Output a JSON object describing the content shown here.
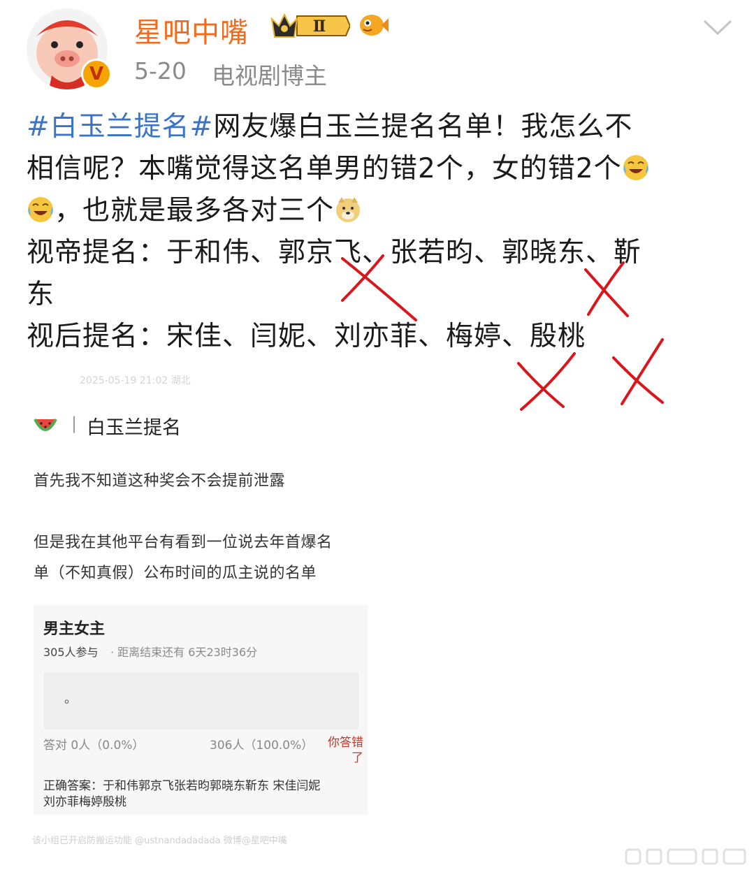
{
  "header": {
    "username": "星吧中嘴",
    "badge_level": "Ⅱ",
    "date": "5-20",
    "role": "电视剧博主"
  },
  "post": {
    "hashtag": "#白玉兰提名#",
    "line1_text": "网友爆白玉兰提名名单！我怎么不",
    "line2_text": "相信呢？本嘴觉得这名单男的错2个，女的错2个",
    "line3_text": "，也就是最多各对三个",
    "actor_line": "视帝提名：于和伟、郭京飞、张若昀、郭晓东、靳",
    "actor_line_cont": "东",
    "actress_line": "视后提名：宋佳、闫妮、刘亦菲、梅婷、殷桃"
  },
  "screenshot": {
    "faint_header": "2025-05-19 21:02 湖北",
    "topic_sep": "|",
    "topic": "白玉兰提名",
    "para1": "首先我不知道这种奖会不会提前泄露",
    "para2_line1": "但是我在其他平台有看到一位说去年首爆名",
    "para2_line2": "单（不知真假）公布时间的瓜主说的名单",
    "card": {
      "title": "男主女主",
      "participants": "305人参与",
      "deadline": "· 距离结束还有 6天23时36分",
      "option_text": "。",
      "correct_stat": "答对  0人（0.0%）",
      "wrong_stat": "306人（100.0%）",
      "you_wrong": "你答错了",
      "answer_line1": "正确答案：于和伟郭京飞张若昀郭晓东靳东 宋佳闫妮",
      "answer_line2": "刘亦菲梅婷殷桃"
    },
    "footer": "该小组已开启防搬运功能  @ustnandadadada    微博@星吧中嘴"
  },
  "colors": {
    "username": "#f26a1b",
    "hashtag": "#3a74c4",
    "meta": "#8a8a8a",
    "red_marks": "#d8161b"
  },
  "icons": [
    "pig-avatar",
    "verified-v-icon",
    "crown-level-icon",
    "fish-icon",
    "chevron-down-icon",
    "laughing-cry-emoji",
    "doge-emoji",
    "watermelon-icon"
  ]
}
